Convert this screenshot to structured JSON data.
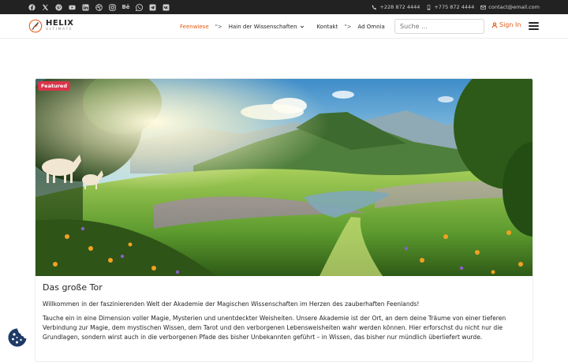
{
  "topbar": {
    "social_icons": [
      "facebook-icon",
      "x-icon",
      "pinterest-icon",
      "youtube-icon",
      "linkedin-icon",
      "dribbble-icon",
      "instagram-icon",
      "behance-icon",
      "whatsapp-icon",
      "telegram-icon",
      "vk-icon"
    ],
    "behance_text": "Bē",
    "phone": "+228 872 4444",
    "mobile": "+775 872 4444",
    "email": "contact@email.com"
  },
  "header": {
    "logo_title": "HELIX",
    "logo_sub": "ULTIMATE",
    "nav": [
      {
        "label": "Feenwiese",
        "active": true
      },
      {
        "sep": "\">"
      },
      {
        "label": "Hain der Wissenschaften",
        "dropdown": true
      },
      {
        "label": "Kontakt"
      },
      {
        "sep2": "\">"
      },
      {
        "label": "Ad Omnia"
      }
    ],
    "search_placeholder": "Suche ...",
    "signin_label": "Sign In",
    "accent": "#e25a14"
  },
  "article": {
    "badge": "Featured",
    "badge_color": "#d9344a",
    "title": "Das große Tor",
    "p1": "Willkommen in der faszinierenden Welt der Akademie der Magischen Wissenschaften im Herzen des zauberhaften Feenlands!",
    "p2": "Tauche ein in eine Dimension voller Magie, Mysterien und unentdeckter Weisheiten. Unsere Akademie ist der Ort, an dem deine Träume von einer tieferen Verbindung zur Magie, dem mystischen Wissen, dem Tarot und den verborgenen Lebensweisheiten wahr werden können. Hier erforschst du nicht nur die Grundlagen, sondern wirst auch in die verborgenen Pfade des bisher Unbekannten geführt – in Wissen, das bisher nur mündlich überliefert wurde."
  }
}
